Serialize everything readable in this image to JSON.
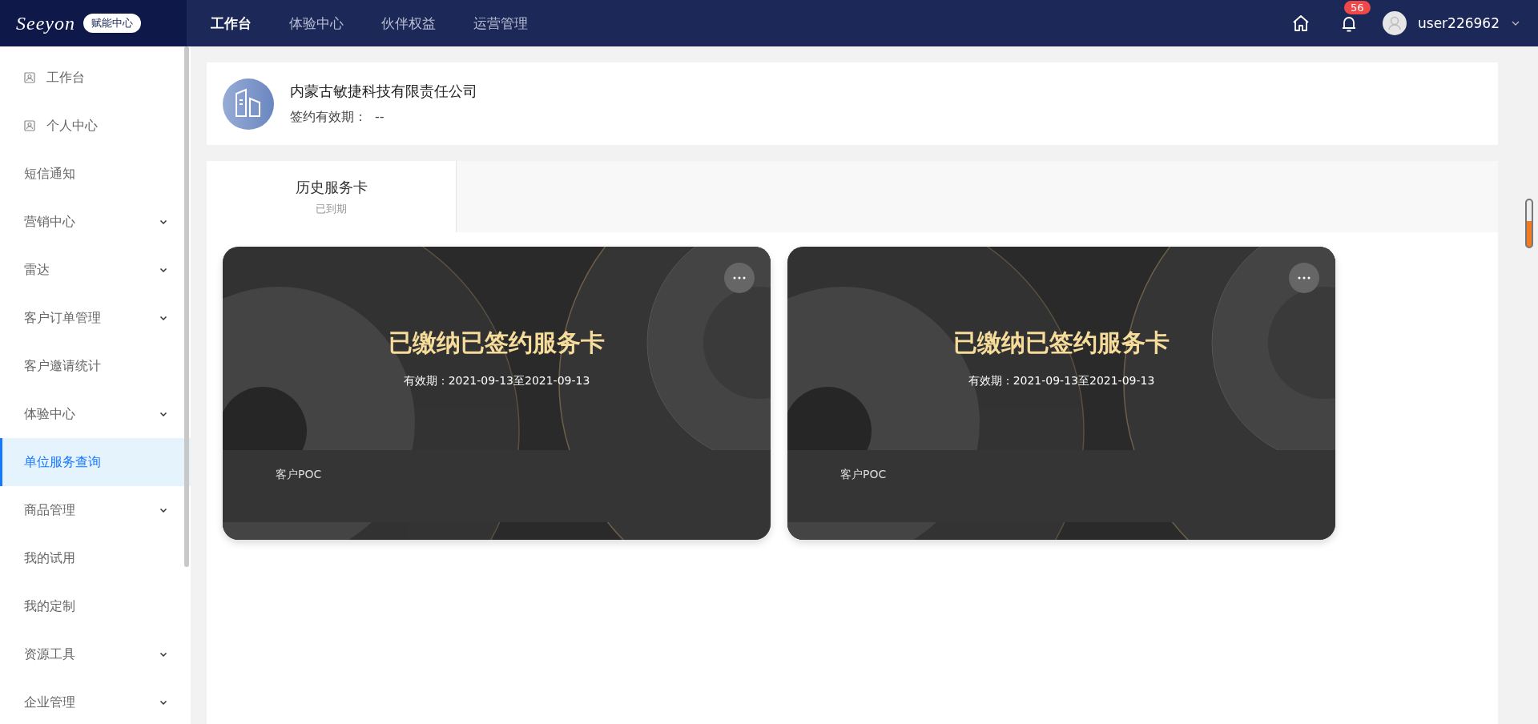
{
  "topbar": {
    "logo": "Seeyon",
    "logo_tag": "赋能中心",
    "nav": [
      {
        "label": "工作台",
        "selected": true
      },
      {
        "label": "体验中心",
        "selected": false
      },
      {
        "label": "伙伴权益",
        "selected": false
      },
      {
        "label": "运营管理",
        "selected": false
      }
    ],
    "notification_count": "56",
    "username": "user226962"
  },
  "sidebar": {
    "items": [
      {
        "label": "工作台",
        "kind": "icon",
        "expandable": false,
        "selected": false
      },
      {
        "label": "个人中心",
        "kind": "icon",
        "expandable": false,
        "selected": false
      },
      {
        "label": "短信通知",
        "kind": "plain",
        "expandable": false,
        "selected": false
      },
      {
        "label": "营销中心",
        "kind": "plain",
        "expandable": true,
        "selected": false
      },
      {
        "label": "雷达",
        "kind": "plain",
        "expandable": true,
        "selected": false
      },
      {
        "label": "客户订单管理",
        "kind": "plain",
        "expandable": true,
        "selected": false
      },
      {
        "label": "客户邀请统计",
        "kind": "plain",
        "expandable": false,
        "selected": false
      },
      {
        "label": "体验中心",
        "kind": "plain",
        "expandable": true,
        "selected": false
      },
      {
        "label": "单位服务查询",
        "kind": "plain",
        "expandable": false,
        "selected": true
      },
      {
        "label": "商品管理",
        "kind": "plain",
        "expandable": true,
        "selected": false
      },
      {
        "label": "我的试用",
        "kind": "plain",
        "expandable": false,
        "selected": false
      },
      {
        "label": "我的定制",
        "kind": "plain",
        "expandable": false,
        "selected": false
      },
      {
        "label": "资源工具",
        "kind": "plain",
        "expandable": true,
        "selected": false
      },
      {
        "label": "企业管理",
        "kind": "plain",
        "expandable": true,
        "selected": false
      }
    ]
  },
  "company": {
    "name": "内蒙古敏捷科技有限责任公司",
    "validity_label": "签约有效期：",
    "validity_value": "--"
  },
  "tabs": [
    {
      "title": "历史服务卡",
      "subtitle": "已到期",
      "selected": true
    }
  ],
  "cards": [
    {
      "title": "已缴纳已签约服务卡",
      "validity": "有效期：2021-09-13至2021-09-13",
      "tag": "客户POC"
    },
    {
      "title": "已缴纳已签约服务卡",
      "validity": "有效期：2021-09-13至2021-09-13",
      "tag": "客户POC"
    }
  ]
}
